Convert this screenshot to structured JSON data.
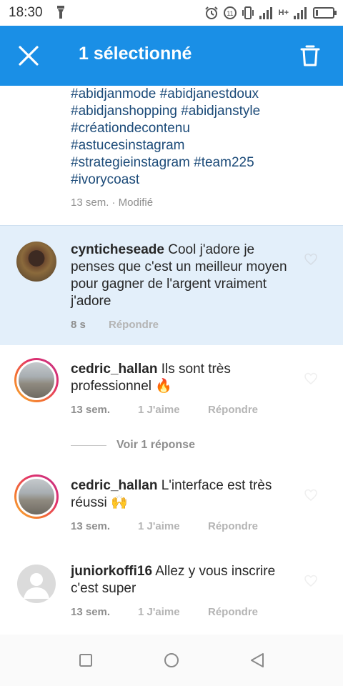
{
  "status_bar": {
    "time": "18:30",
    "network": "H+"
  },
  "app_bar": {
    "title": "1 sélectionné"
  },
  "caption": {
    "hashtag_lines": [
      "#abidjanmode #abidjanestdoux",
      "#abidjanshopping #abidjanstyle",
      "#créationdecontenu",
      "#astucesinstagram",
      "#strategieinstagram #team225",
      "#ivorycoast"
    ],
    "meta": "13 sem. · Modifié"
  },
  "comments": [
    {
      "username": "cyntichesеade",
      "text": "Cool j'adore je penses que c'est un meilleur moyen pour gagner de l'argent vraiment j'adore",
      "time": "8 s",
      "likes": "",
      "reply": "Répondre"
    },
    {
      "username": "cedric_hallan",
      "text": "Ils sont très professionnel 🔥",
      "time": "13 sem.",
      "likes": "1 J'aime",
      "reply": "Répondre"
    },
    {
      "username": "cedric_hallan",
      "text": "L'interface est très réussi 🙌",
      "time": "13 sem.",
      "likes": "1 J'aime",
      "reply": "Répondre"
    },
    {
      "username": "juniorkoffi16",
      "text": "Allez y vous inscrire c'est super",
      "time": "13 sem.",
      "likes": "1 J'aime",
      "reply": "Répondre"
    }
  ],
  "view_replies": "Voir 1 réponse",
  "colors": {
    "accent": "#1a8fe6",
    "selected_bg": "#e3effa",
    "hashtag": "#1b4a78"
  }
}
